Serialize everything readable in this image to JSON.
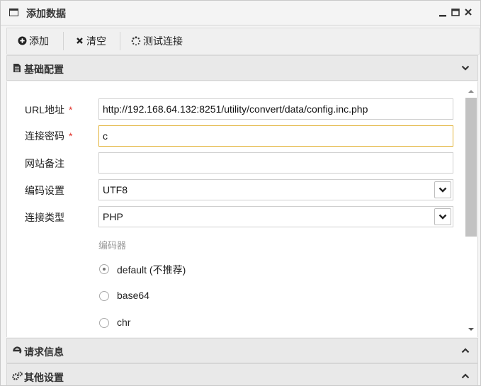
{
  "window": {
    "title": "添加数据",
    "controls": [
      "minimize-icon",
      "maximize-icon",
      "close-icon"
    ]
  },
  "toolbar": {
    "add_label": "添加",
    "clear_label": "清空",
    "test_label": "测试连接"
  },
  "sections": {
    "basic": {
      "label": "基础配置",
      "icon": "file-icon",
      "state": "expanded"
    },
    "request": {
      "label": "请求信息",
      "icon": "e-icon",
      "state": "collapsed"
    },
    "other": {
      "label": "其他设置",
      "icon": "gears-icon",
      "state": "collapsed"
    }
  },
  "form": {
    "url": {
      "label": "URL地址",
      "required": "*",
      "value": "http://192.168.64.132:8251/utility/convert/data/config.inc.php"
    },
    "password": {
      "label": "连接密码",
      "required": "*",
      "value": "c"
    },
    "note": {
      "label": "网站备注",
      "value": ""
    },
    "encoding": {
      "label": "编码设置",
      "value": "UTF8"
    },
    "type": {
      "label": "连接类型",
      "value": "PHP"
    },
    "encoder": {
      "label": "编码器",
      "options": [
        "default (不推荐)",
        "base64",
        "chr"
      ],
      "selected": "default (不推荐)"
    }
  },
  "colors": {
    "required_star": "#e0322a",
    "focus_border": "#e2b338",
    "header_bg": "#e9e9e9"
  }
}
